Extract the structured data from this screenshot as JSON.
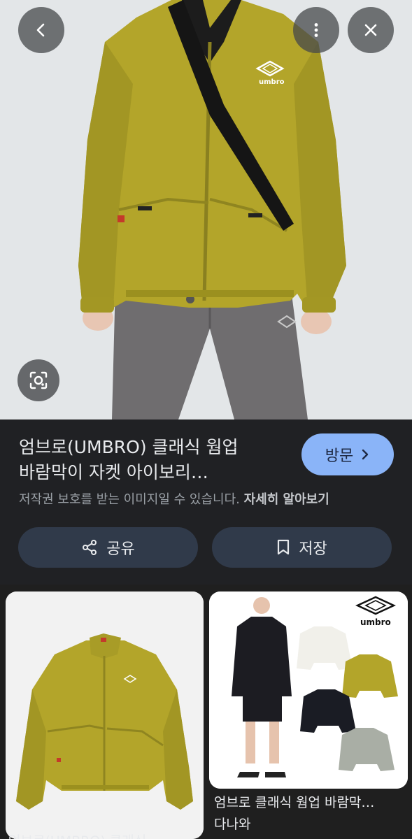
{
  "hero": {
    "image_alt": "umbro",
    "back_icon": "back-arrow-icon",
    "more_icon": "more-vert-icon",
    "close_icon": "close-icon",
    "lens_icon": "lens-icon"
  },
  "result": {
    "title_line1": "엄브로(UMBRO) 클래식 웜업",
    "title_line2": "바람막이 자켓 아이보리…",
    "visit_label": "방문",
    "copyright_text": "저작권 보호를 받는 이미지일 수 있습니다.",
    "learn_more": "자세히 알아보기",
    "share_label": "공유",
    "save_label": "저장"
  },
  "related": [
    {
      "caption": "엄브로(UMBRO) 클래식",
      "source": ""
    },
    {
      "caption": "엄브로 클래식 웜업 바람막…",
      "source": "다나와",
      "brand": "umbro"
    }
  ],
  "colors": {
    "background": "#202124",
    "accent": "#8ab4f8",
    "pill": "#303a4a",
    "jacket": "#b3a52a"
  }
}
